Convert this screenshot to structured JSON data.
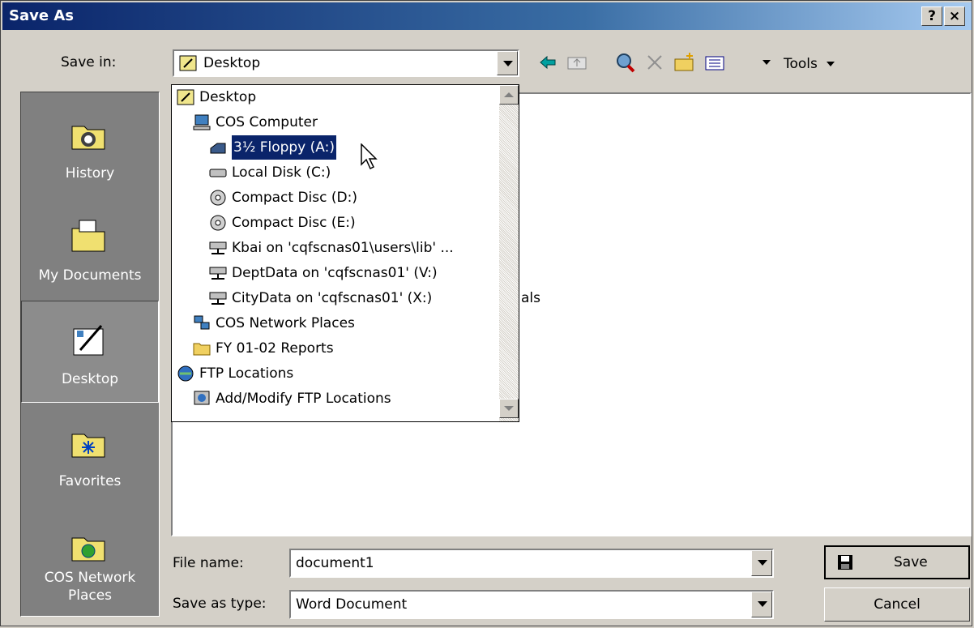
{
  "window": {
    "title": "Save As",
    "help_glyph": "?",
    "close_glyph": "×"
  },
  "toolbar": {
    "save_in_label": "Save in:",
    "save_in_value": "Desktop",
    "tools_label": "Tools",
    "icons": [
      "back-icon",
      "up-folder-icon",
      "search-web-icon",
      "delete-icon",
      "new-folder-icon",
      "views-icon"
    ]
  },
  "places": [
    {
      "label": "History",
      "icon": "history-icon"
    },
    {
      "label": "My Documents",
      "icon": "my-documents-icon"
    },
    {
      "label": "Desktop",
      "icon": "desktop-icon"
    },
    {
      "label": "Favorites",
      "icon": "favorites-icon"
    },
    {
      "label": "COS Network Places",
      "icon": "network-places-icon"
    }
  ],
  "dropdown_items": [
    {
      "label": "Desktop",
      "icon": "desktop-icon"
    },
    {
      "label": "COS Computer",
      "icon": "computer-icon"
    },
    {
      "label": "3½ Floppy (A:)",
      "icon": "floppy-icon",
      "selected": true
    },
    {
      "label": "Local Disk (C:)",
      "icon": "hard-disk-icon"
    },
    {
      "label": "Compact Disc (D:)",
      "icon": "cd-icon"
    },
    {
      "label": "Compact Disc (E:)",
      "icon": "cd-icon"
    },
    {
      "label": "Kbai on 'cqfscnas01\\users\\lib' ...",
      "icon": "network-drive-icon"
    },
    {
      "label": "DeptData on 'cqfscnas01' (V:)",
      "icon": "network-drive-icon"
    },
    {
      "label": "CityData on 'cqfscnas01' (X:)",
      "icon": "network-drive-icon"
    },
    {
      "label": "COS Network Places",
      "icon": "network-places-icon"
    },
    {
      "label": "FY 01-02 Reports",
      "icon": "folder-icon"
    },
    {
      "label": "FTP Locations",
      "icon": "ftp-icon"
    },
    {
      "label": "Add/Modify FTP Locations",
      "icon": "ftp-modify-icon"
    }
  ],
  "file_list_partial_text": "als",
  "file_name": {
    "label": "File name:",
    "value": "document1"
  },
  "file_type": {
    "label": "Save as type:",
    "value": "Word Document"
  },
  "buttons": {
    "save": "Save",
    "cancel": "Cancel"
  },
  "colors": {
    "title_bar": "#0a246a",
    "selection": "#0a246a",
    "face": "#d4d0c8"
  }
}
